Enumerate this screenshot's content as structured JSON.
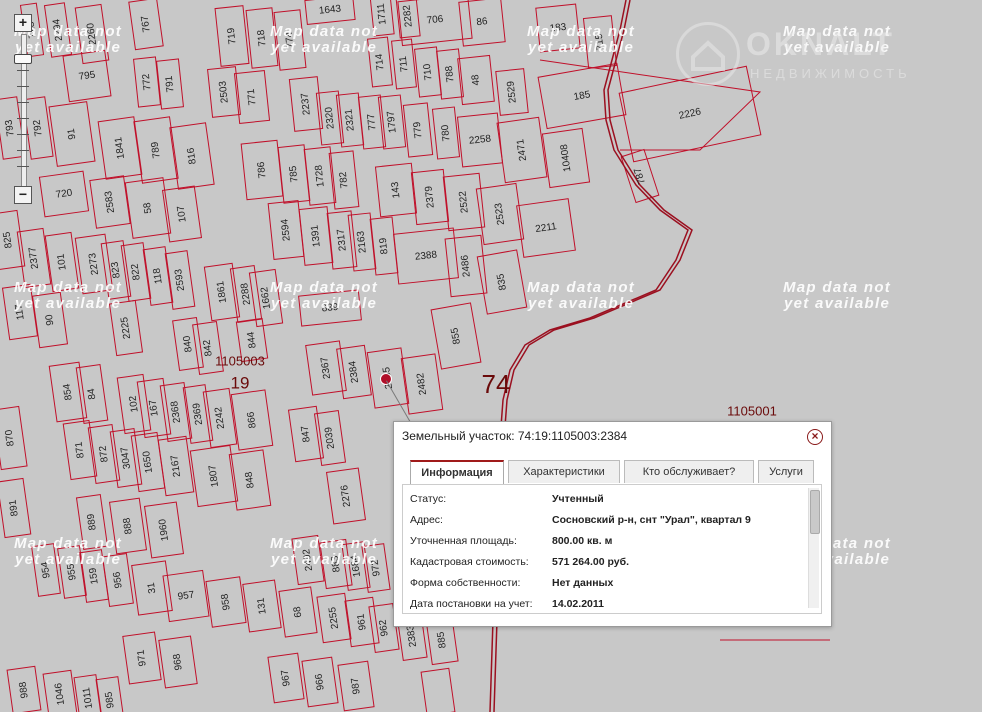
{
  "map": {
    "watermark_text": [
      "Map data not",
      "yet available"
    ],
    "brand": {
      "name": "OKNALT",
      "subtitle": "НЕДВИЖИМОСТЬ"
    },
    "zoom": {
      "plus_label": "+",
      "minus_label": "−"
    },
    "district_labels": [
      {
        "text": "1105003"
      },
      {
        "text": "1105001"
      },
      {
        "text": "19"
      },
      {
        "text": "74"
      }
    ],
    "parcel_numbers": [
      "728",
      "2294",
      "2260",
      "767",
      "795",
      "793",
      "792",
      "91",
      "720",
      "719",
      "718",
      "774",
      "2503",
      "771",
      "772",
      "791",
      "1841",
      "789",
      "816",
      "2583",
      "58",
      "107",
      "1643",
      "1711",
      "2282",
      "706",
      "86",
      "183",
      "715",
      "714",
      "711",
      "710",
      "788",
      "48",
      "2529",
      "185",
      "2226",
      "2237",
      "2320",
      "2321",
      "777",
      "1797",
      "779",
      "780",
      "2258",
      "2471",
      "10408",
      "787",
      "786",
      "785",
      "1728",
      "782",
      "143",
      "2379",
      "2522",
      "2523",
      "2211",
      "825",
      "2377",
      "101",
      "2273",
      "823",
      "822",
      "118",
      "2593",
      "2594",
      "1391",
      "2317",
      "2163",
      "819",
      "2388",
      "2486",
      "835",
      "117",
      "90",
      "2225",
      "1861",
      "2288",
      "1662",
      "839",
      "840",
      "842",
      "844",
      "2367",
      "2384",
      "2485",
      "2482",
      "855",
      "854",
      "84",
      "102",
      "167",
      "2368",
      "2369",
      "2242",
      "866",
      "870",
      "871",
      "872",
      "3047",
      "1650",
      "2167",
      "1807",
      "848",
      "847",
      "2039",
      "2276",
      "891",
      "889",
      "888",
      "1960",
      "954",
      "955",
      "159",
      "956",
      "31",
      "957",
      "958",
      "131",
      "68",
      "2255",
      "961",
      "962",
      "2383",
      "885",
      "2492",
      "883",
      "1684",
      "972",
      "971",
      "968",
      "967",
      "966",
      "987",
      "988",
      "1046",
      "1011",
      "985"
    ]
  },
  "popup": {
    "title": "Земельный участок: 74:19:1105003:2384",
    "close_label": "×",
    "tabs": [
      {
        "label": "Информация",
        "active": true
      },
      {
        "label": "Характеристики",
        "active": false
      },
      {
        "label": "Кто обслуживает?",
        "active": false
      },
      {
        "label": "Услуги",
        "active": false
      }
    ],
    "rows": [
      {
        "label": "Статус:",
        "value": "Учтенный"
      },
      {
        "label": "Адрес:",
        "value": "Сосновский р-н, снт \"Урал\", квартал 9"
      },
      {
        "label": "Уточненная площадь:",
        "value": "800.00 кв. м"
      },
      {
        "label": "Кадастровая стоимость:",
        "value": "571 264.00 руб."
      },
      {
        "label": "Форма собственности:",
        "value": "Нет данных"
      },
      {
        "label": "Дата постановки на учет:",
        "value": "14.02.2011"
      }
    ]
  },
  "colors": {
    "background": "#c8c8c8",
    "parcel_border": "#c0102a",
    "road": "#9b1020",
    "popup_accent": "#a01a1a"
  }
}
